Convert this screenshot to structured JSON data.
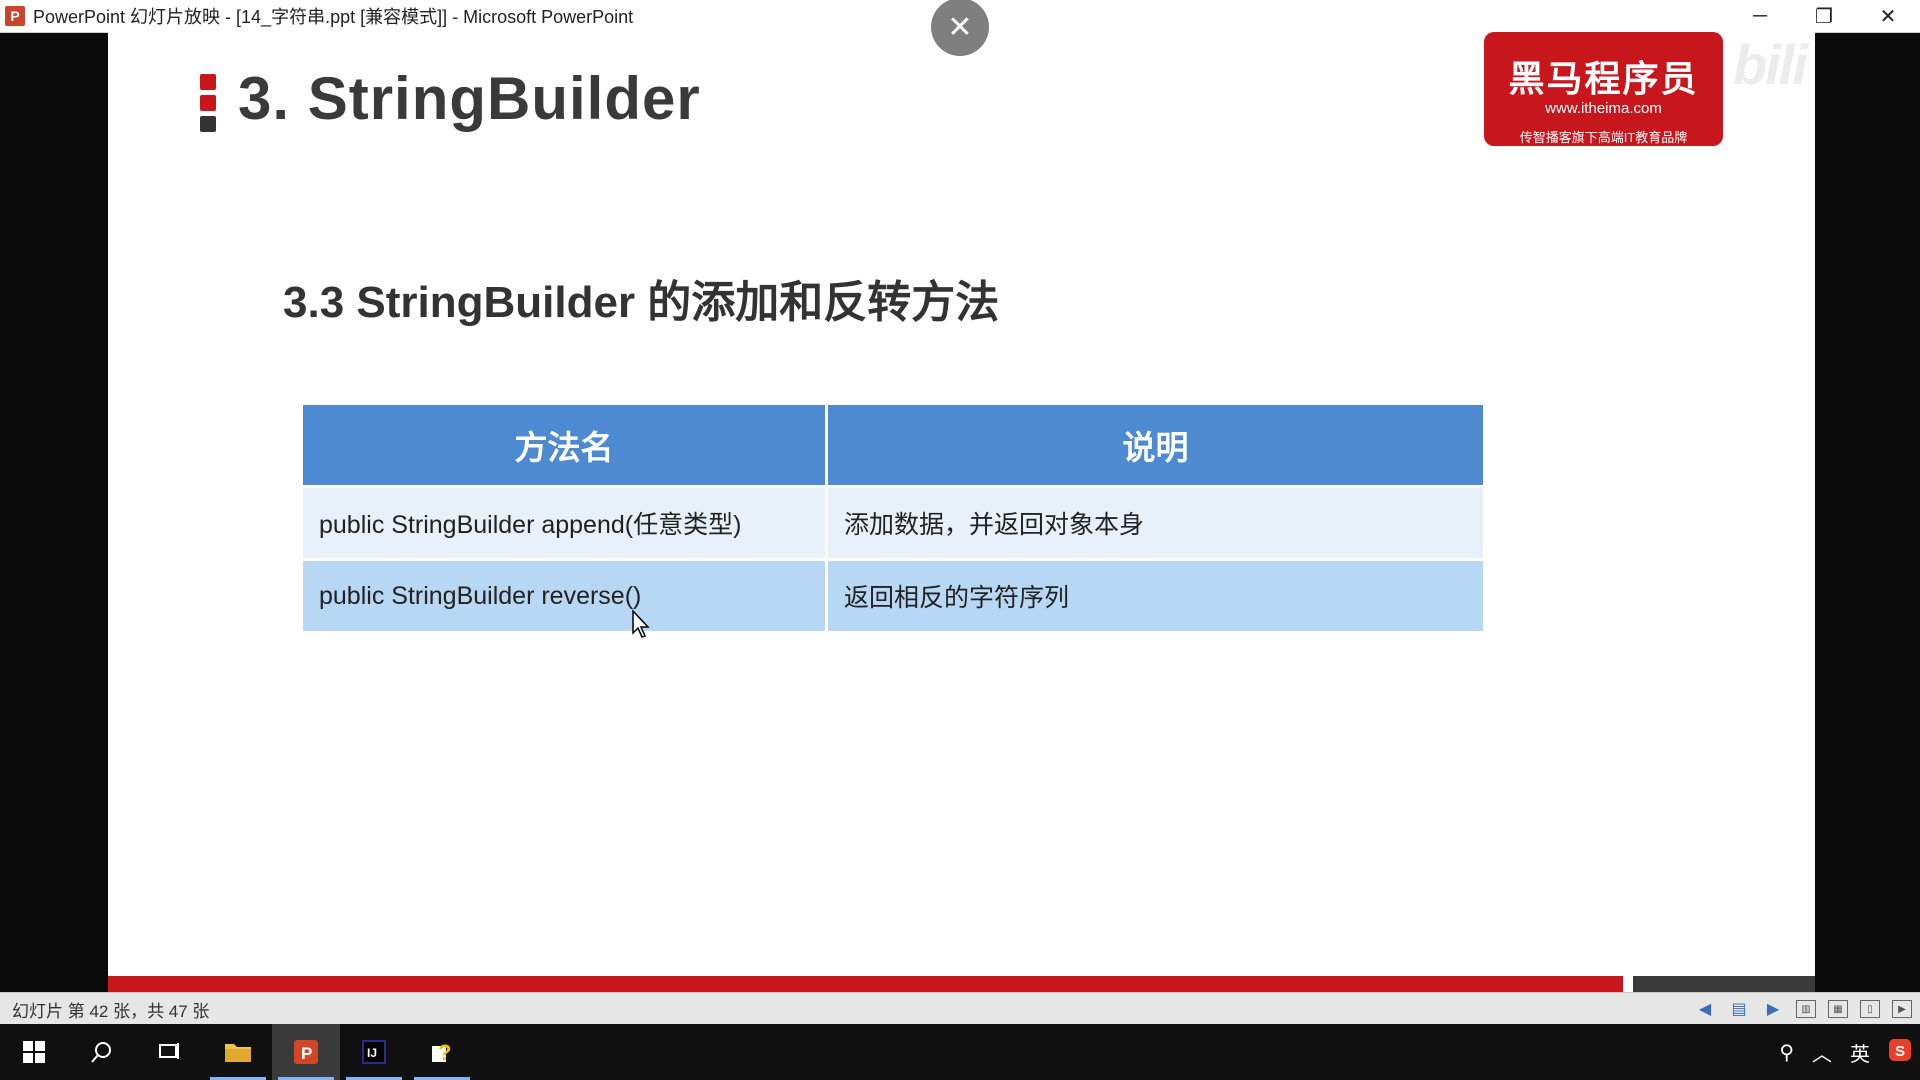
{
  "window": {
    "title": "PowerPoint 幻灯片放映 - [14_字符串.ppt [兼容模式]] - Microsoft PowerPoint",
    "app_icon_letter": "P",
    "minimize": "─",
    "restore": "❐",
    "close": "✕"
  },
  "overlay": {
    "close": "✕"
  },
  "slide": {
    "title": "3. StringBuilder",
    "logo": {
      "brand": "黑马程序员",
      "url": "www.itheima.com",
      "slogan": "传智播客旗下高端IT教育品牌"
    },
    "watermark": "bili",
    "section_heading": "3.3 StringBuilder 的添加和反转方法",
    "table": {
      "headers": [
        "方法名",
        "说明"
      ],
      "rows": [
        [
          "public StringBuilder append(任意类型)",
          "添加数据，并返回对象本身"
        ],
        [
          "public StringBuilder reverse()",
          "返回相反的字符序列"
        ]
      ]
    }
  },
  "statusbar": {
    "slide_count": "幻灯片 第 42 张，共 47 张"
  },
  "taskbar": {
    "tray_lang": "英"
  },
  "colors": {
    "header_blue": "#4e8ad2",
    "row1": "#e8f1fa",
    "row2": "#b7d7f4",
    "brand_red": "#c8161d"
  }
}
